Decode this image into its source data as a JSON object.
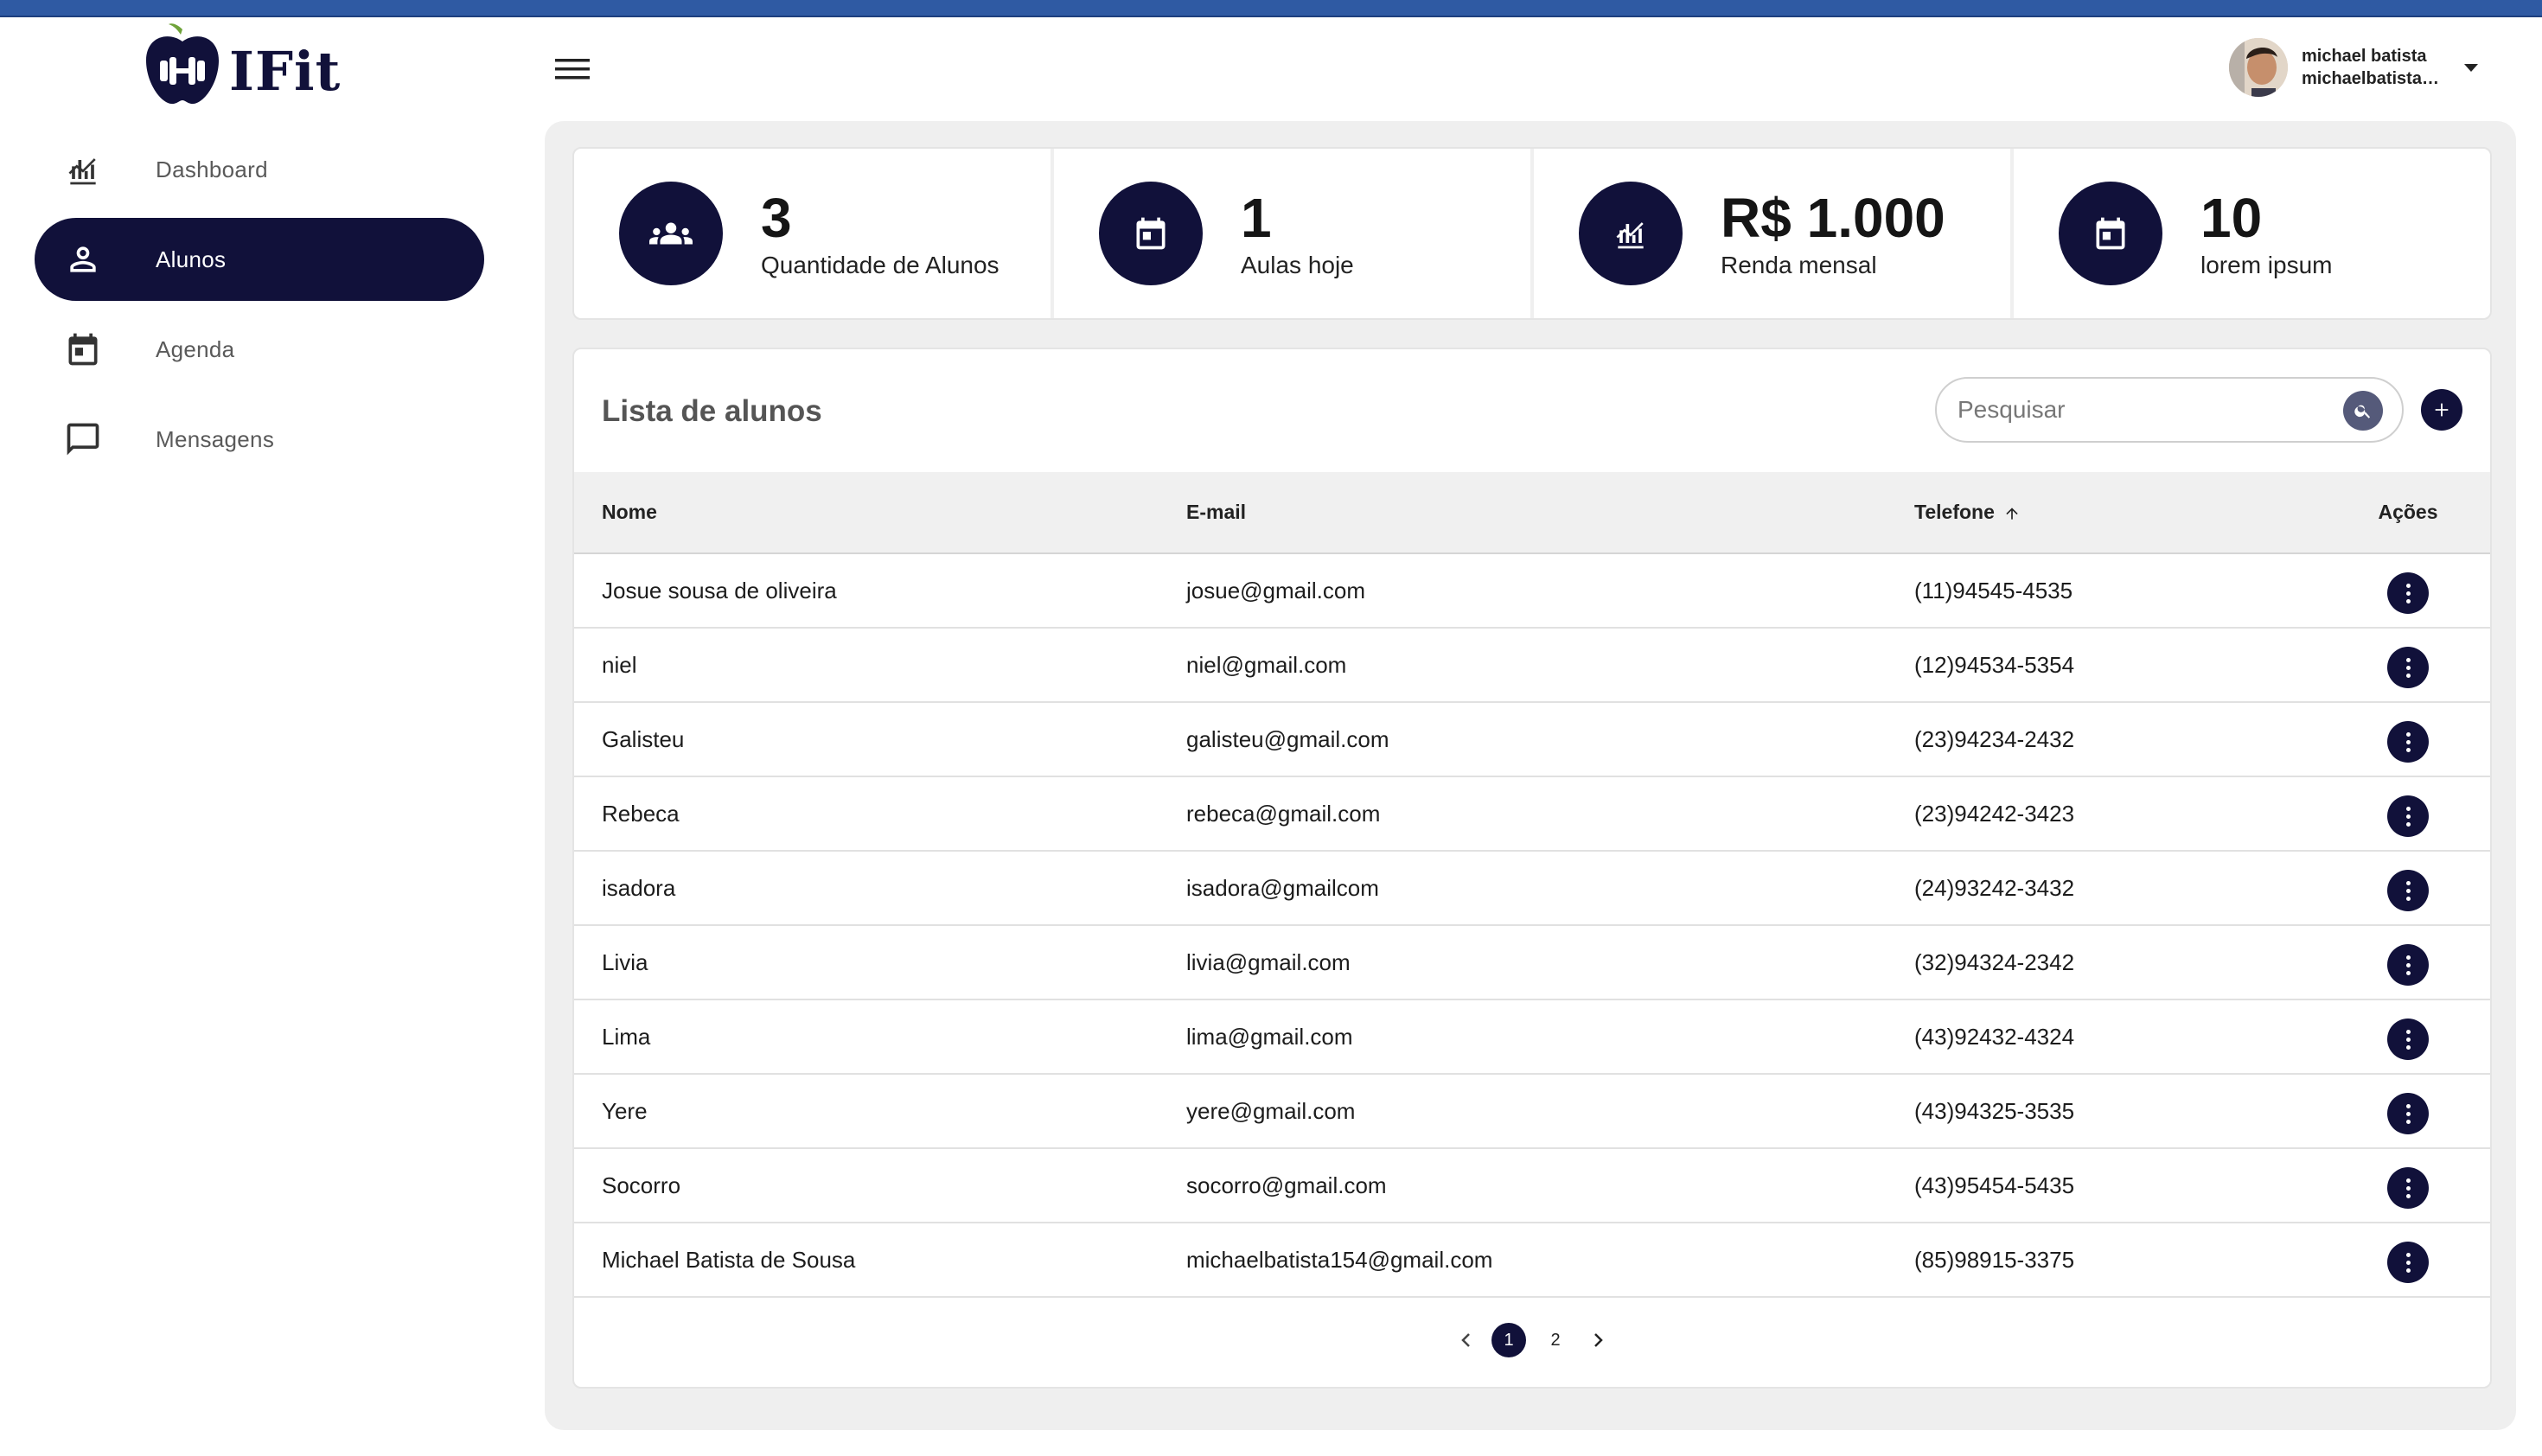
{
  "app": {
    "logo_text": "IFit"
  },
  "sidebar": {
    "items": [
      {
        "label": "Dashboard",
        "icon": "chart-icon",
        "active": false
      },
      {
        "label": "Alunos",
        "icon": "person-icon",
        "active": true
      },
      {
        "label": "Agenda",
        "icon": "calendar-icon",
        "active": false
      },
      {
        "label": "Mensagens",
        "icon": "message-icon",
        "active": false
      }
    ]
  },
  "header": {
    "user_name": "michael batista",
    "user_email": "michaelbatistas..."
  },
  "stats": [
    {
      "value": "3",
      "label": "Quantidade de Alunos",
      "icon": "group-icon"
    },
    {
      "value": "1",
      "label": "Aulas hoje",
      "icon": "calendar-icon"
    },
    {
      "value": "R$ 1.000",
      "label": "Renda mensal",
      "icon": "chart-icon"
    },
    {
      "value": "10",
      "label": "lorem ipsum",
      "icon": "calendar-icon"
    }
  ],
  "list": {
    "title": "Lista de alunos",
    "search_placeholder": "Pesquisar",
    "columns": {
      "name": "Nome",
      "email": "E-mail",
      "phone": "Telefone",
      "actions": "Ações"
    },
    "rows": [
      {
        "name": "Josue sousa de oliveira",
        "email": "josue@gmail.com",
        "phone": "(11)94545-4535"
      },
      {
        "name": "niel",
        "email": "niel@gmail.com",
        "phone": "(12)94534-5354"
      },
      {
        "name": "Galisteu",
        "email": "galisteu@gmail.com",
        "phone": "(23)94234-2432"
      },
      {
        "name": "Rebeca",
        "email": "rebeca@gmail.com",
        "phone": "(23)94242-3423"
      },
      {
        "name": "isadora",
        "email": "isadora@gmailcom",
        "phone": "(24)93242-3432"
      },
      {
        "name": "Livia",
        "email": "livia@gmail.com",
        "phone": "(32)94324-2342"
      },
      {
        "name": "Lima",
        "email": "lima@gmail.com",
        "phone": "(43)92432-4324"
      },
      {
        "name": "Yere",
        "email": "yere@gmail.com",
        "phone": "(43)94325-3535"
      },
      {
        "name": "Socorro",
        "email": "socorro@gmail.com",
        "phone": "(43)95454-5435"
      },
      {
        "name": "Michael Batista de Sousa",
        "email": "michaelbatista154@gmail.com",
        "phone": "(85)98915-3375"
      }
    ]
  },
  "pagination": {
    "pages": [
      "1",
      "2"
    ],
    "current": "1"
  },
  "colors": {
    "primary": "#11113a",
    "panel_bg": "#efefef",
    "topbar": "#2f5aa3"
  }
}
